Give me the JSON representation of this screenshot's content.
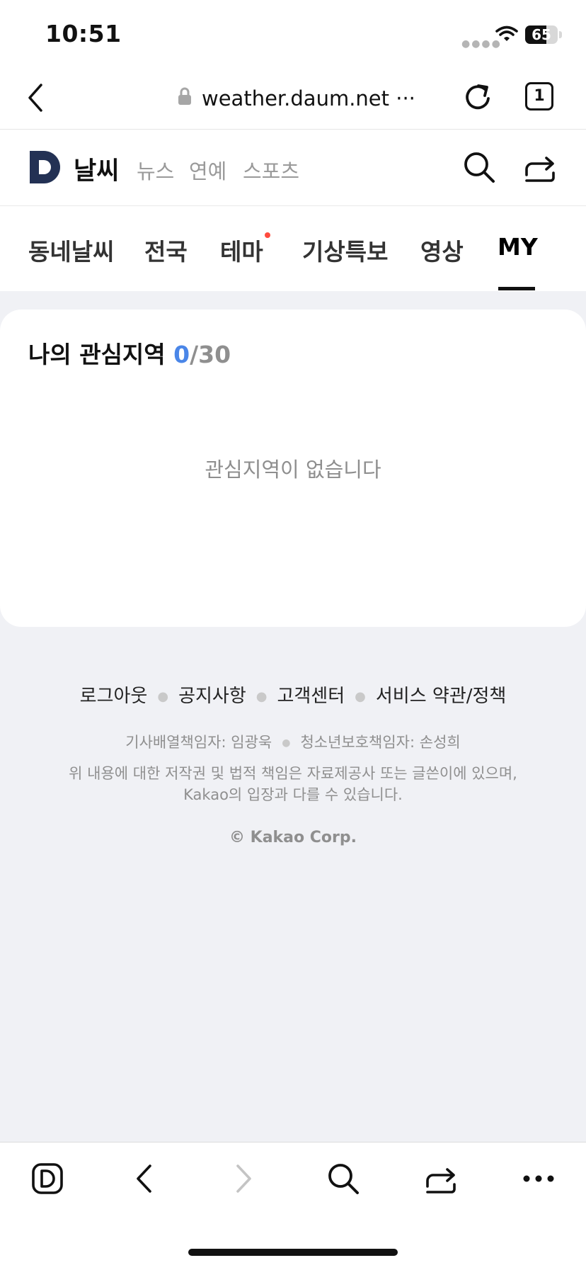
{
  "status_bar": {
    "time": "10:51",
    "battery": "65",
    "battery_level": 0.65
  },
  "browser": {
    "url": "weather.daum.net ···",
    "tab_count": "1"
  },
  "site": {
    "logo_text": "날씨",
    "links": [
      "뉴스",
      "연예",
      "스포츠"
    ]
  },
  "tabs": [
    "동네날씨",
    "전국",
    "테마",
    "기상특보",
    "영상",
    "MY"
  ],
  "active_tab": "MY",
  "card": {
    "title": "나의 관심지역",
    "count_current": "0",
    "count_total": "/30",
    "empty_message": "관심지역이 없습니다"
  },
  "footer": {
    "links": [
      "로그아웃",
      "공지사항",
      "고객센터",
      "서비스 약관/정책"
    ],
    "editor": "기사배열책임자: 임광욱",
    "youth": "청소년보호책임자: 손성희",
    "notice_line1": "위 내용에 대한 저작권 및 법적 책임은 자료제공사 또는 글쓴이에 있으며,",
    "notice_line2": "Kakao의 입장과 다를 수 있습니다.",
    "copyright": "© Kakao Corp."
  },
  "colors": {
    "accent": "#4a86e8",
    "background": "#f0f1f5",
    "logo": "#233154",
    "badge": "#ff4b3e"
  }
}
